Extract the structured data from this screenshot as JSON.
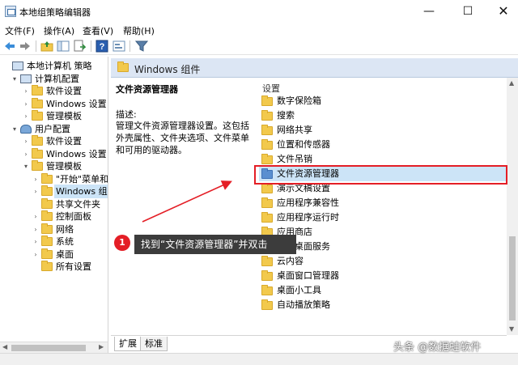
{
  "window": {
    "title": "本地组策略编辑器",
    "controls": {
      "minimize": "—",
      "maximize": "☐",
      "close": "✕"
    }
  },
  "menu": [
    "文件(F)",
    "操作(A)",
    "查看(V)",
    "帮助(H)"
  ],
  "toolbar": {
    "icons": [
      "back-arrow-icon",
      "forward-arrow-icon",
      "up-folder-icon",
      "show-tree-icon",
      "export-list-icon",
      "help-icon",
      "properties-icon",
      "filter-icon"
    ]
  },
  "tree": {
    "items": [
      {
        "label": "本地计算机 策略",
        "level": 0,
        "expander": "",
        "icon": "computer-policy-icon"
      },
      {
        "label": "计算机配置",
        "level": 1,
        "expander": "▾",
        "icon": "computer-icon"
      },
      {
        "label": "软件设置",
        "level": 2,
        "expander": "›",
        "icon": "folder-icon"
      },
      {
        "label": "Windows 设置",
        "level": 2,
        "expander": "›",
        "icon": "folder-icon"
      },
      {
        "label": "管理模板",
        "level": 2,
        "expander": "›",
        "icon": "folder-icon"
      },
      {
        "label": "用户配置",
        "level": 1,
        "expander": "▾",
        "icon": "user-icon"
      },
      {
        "label": "软件设置",
        "level": 2,
        "expander": "›",
        "icon": "folder-icon"
      },
      {
        "label": "Windows 设置",
        "level": 2,
        "expander": "›",
        "icon": "folder-icon"
      },
      {
        "label": "管理模板",
        "level": 2,
        "expander": "▾",
        "icon": "folder-icon"
      },
      {
        "label": "\"开始\"菜单和任",
        "level": 3,
        "expander": "›",
        "icon": "folder-icon"
      },
      {
        "label": "Windows 组件",
        "level": 3,
        "expander": "›",
        "icon": "folder-icon",
        "selected": true
      },
      {
        "label": "共享文件夹",
        "level": 3,
        "expander": "",
        "icon": "folder-icon"
      },
      {
        "label": "控制面板",
        "level": 3,
        "expander": "›",
        "icon": "folder-icon"
      },
      {
        "label": "网络",
        "level": 3,
        "expander": "›",
        "icon": "folder-icon"
      },
      {
        "label": "系统",
        "level": 3,
        "expander": "›",
        "icon": "folder-icon"
      },
      {
        "label": "桌面",
        "level": 3,
        "expander": "›",
        "icon": "folder-icon"
      },
      {
        "label": "所有设置",
        "level": 3,
        "expander": "",
        "icon": "folder-icon"
      }
    ]
  },
  "content": {
    "header": "Windows 组件",
    "selected_title": "文件资源管理器",
    "description_label": "描述:",
    "description": "管理文件资源管理器设置。这包括外壳属性、文件夹选项、文件菜单和可用的驱动器。",
    "column_header": "设置",
    "items": [
      "数字保险箱",
      "搜索",
      "网络共享",
      "位置和传感器",
      "文件吊销",
      "文件资源管理器",
      "演示文稿设置",
      "应用程序兼容性",
      "应用程序运行时",
      "应用商店",
      "远程桌面服务",
      "云内容",
      "桌面窗口管理器",
      "桌面小工具",
      "自动播放策略"
    ],
    "selected_index": 5
  },
  "tabs": [
    "扩展",
    "标准"
  ],
  "annotation": {
    "number": "1",
    "text": "找到“文件资源管理器”并双击"
  },
  "watermark": "头条 @数据蛙软件"
}
